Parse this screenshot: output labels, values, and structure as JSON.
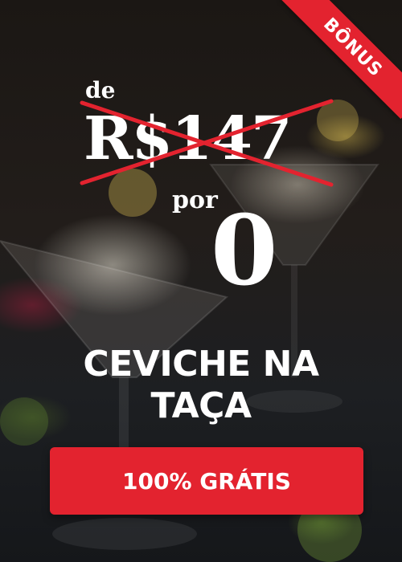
{
  "ribbon": {
    "label": "BÔNUS"
  },
  "offer": {
    "from_label": "de",
    "old_price": "R$147",
    "to_label": "por",
    "new_price": "0"
  },
  "title": {
    "line1": "CEVICHE NA",
    "line2": "TAÇA"
  },
  "cta": {
    "label": "100% GRÁTIS"
  },
  "colors": {
    "accent": "#e3232f",
    "text": "#ffffff",
    "background": "#1b1714"
  }
}
